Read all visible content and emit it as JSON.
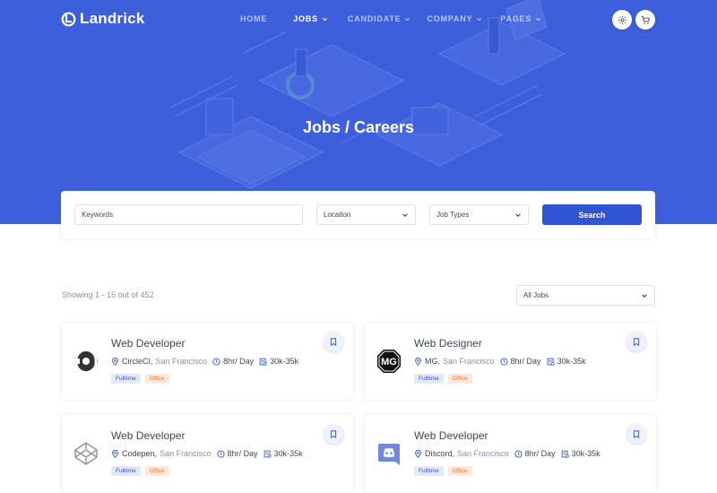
{
  "brand": {
    "name": "Landrick",
    "color": "#3d5fdc",
    "accent": "#2f55d4"
  },
  "nav": {
    "items": [
      {
        "label": "HOME",
        "active": false,
        "dropdown": false
      },
      {
        "label": "JOBS",
        "active": true,
        "dropdown": true
      },
      {
        "label": "CANDIDATE",
        "active": false,
        "dropdown": true
      },
      {
        "label": "COMPANY",
        "active": false,
        "dropdown": true
      },
      {
        "label": "PAGES",
        "active": false,
        "dropdown": true
      }
    ],
    "icons": [
      "gear-icon",
      "cart-icon"
    ]
  },
  "hero": {
    "title": "Jobs / Careers"
  },
  "search": {
    "keywords_placeholder": "Keywords",
    "location_value": "Location",
    "job_types_value": "Job Types",
    "button_label": "Search"
  },
  "results": {
    "showing_text": "Showing 1 - 15 out of 452",
    "sort_value": "All Jobs"
  },
  "jobs": [
    {
      "title": "Web Developer",
      "company": "CircleCI",
      "city": "San Francisco",
      "hours": "8hr/ Day",
      "salary": "30k-35k",
      "tags": [
        "Fulltime",
        "Office"
      ],
      "logo": "circleci-logo"
    },
    {
      "title": "Web Designer",
      "company": "MG",
      "city": "San Francisco",
      "hours": "8hr/ Day",
      "salary": "30k-35k",
      "tags": [
        "Fulltime",
        "Office"
      ],
      "logo": "mg-logo"
    },
    {
      "title": "Web Developer",
      "company": "Codepen",
      "city": "San Francisco",
      "hours": "8hr/ Day",
      "salary": "30k-35k",
      "tags": [
        "Fulltime",
        "Office"
      ],
      "logo": "codepen-logo"
    },
    {
      "title": "Web Developer",
      "company": "Discord",
      "city": "San Francisco",
      "hours": "8hr/ Day",
      "salary": "30k-35k",
      "tags": [
        "Fulltime",
        "Office"
      ],
      "logo": "discord-logo"
    }
  ]
}
